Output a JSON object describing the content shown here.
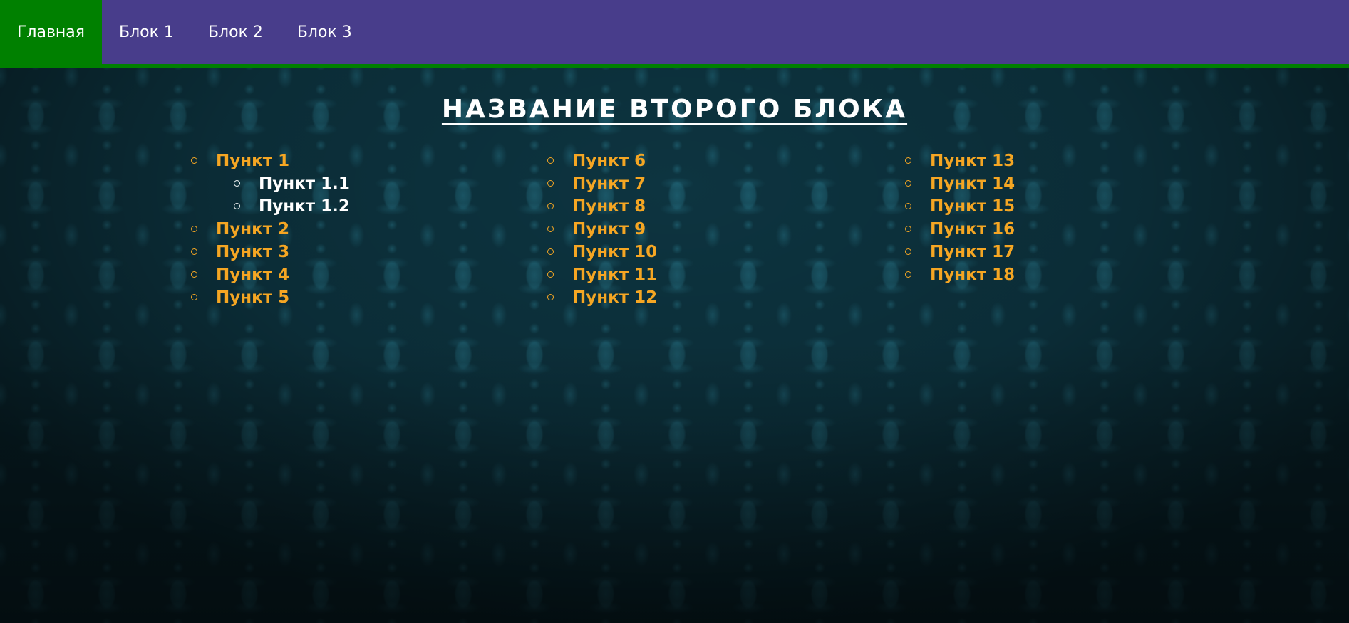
{
  "nav": {
    "items": [
      {
        "label": "Главная",
        "active": true
      },
      {
        "label": "Блок 1",
        "active": false
      },
      {
        "label": "Блок 2",
        "active": false
      },
      {
        "label": "Блок 3",
        "active": false
      }
    ]
  },
  "main": {
    "title": "НАЗВАНИЕ ВТОРОГО БЛОКА",
    "columns": [
      {
        "items": [
          {
            "label": "Пункт 1"
          },
          {
            "label": "Пункт 1.1",
            "nested": true
          },
          {
            "label": "Пункт 1.2",
            "nested": true
          },
          {
            "label": "Пункт 2"
          },
          {
            "label": "Пункт 3"
          },
          {
            "label": "Пункт 4"
          },
          {
            "label": "Пункт 5"
          }
        ]
      },
      {
        "items": [
          {
            "label": "Пункт 6"
          },
          {
            "label": "Пункт 7"
          },
          {
            "label": "Пункт 8"
          },
          {
            "label": "Пункт 9"
          },
          {
            "label": "Пункт 10"
          },
          {
            "label": "Пункт 11"
          },
          {
            "label": "Пункт 12"
          }
        ]
      },
      {
        "items": [
          {
            "label": "Пункт 13"
          },
          {
            "label": "Пункт 14"
          },
          {
            "label": "Пункт 15"
          },
          {
            "label": "Пункт 16"
          },
          {
            "label": "Пункт 17"
          },
          {
            "label": "Пункт 18"
          }
        ]
      }
    ]
  },
  "colors": {
    "nav_background": "#483d8b",
    "nav_active": "#008000",
    "nav_border": "#008000",
    "list_item": "#f5a623",
    "nested_item": "#ffffff",
    "title": "#ffffff",
    "background": "#0d3440"
  }
}
